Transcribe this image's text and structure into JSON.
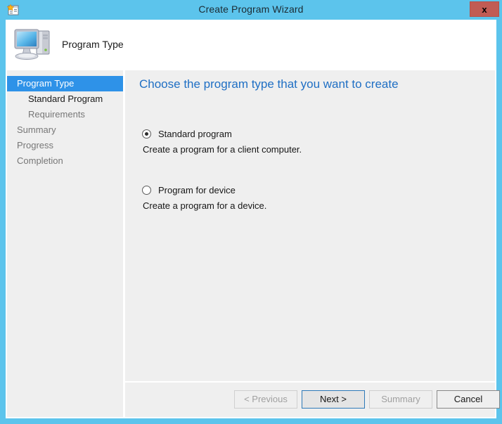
{
  "window": {
    "title": "Create Program Wizard",
    "icon": "new-program-window-icon",
    "close_label": "x",
    "accent_color": "#5CC4EC",
    "close_button_color": "#C15C54"
  },
  "header": {
    "icon": "computer-icon",
    "label": "Program Type"
  },
  "sidebar": {
    "items": [
      {
        "label": "Program Type",
        "state": "active",
        "indent": false
      },
      {
        "label": "Standard Program",
        "state": "completed",
        "indent": true
      },
      {
        "label": "Requirements",
        "state": "pending",
        "indent": true
      },
      {
        "label": "Summary",
        "state": "pending",
        "indent": false
      },
      {
        "label": "Progress",
        "state": "pending",
        "indent": false
      },
      {
        "label": "Completion",
        "state": "pending",
        "indent": false
      }
    ],
    "active_color": "#2E92E8"
  },
  "content": {
    "heading": "Choose the program type that you want to create",
    "heading_color": "#1F6FC4",
    "options": [
      {
        "label": "Standard program",
        "description": "Create a program for a client computer.",
        "selected": true
      },
      {
        "label": "Program for device",
        "description": "Create a program for a device.",
        "selected": false
      }
    ]
  },
  "buttons": {
    "previous": {
      "label": "< Previous",
      "state": "disabled"
    },
    "next": {
      "label": "Next >",
      "state": "focused"
    },
    "summary": {
      "label": "Summary",
      "state": "disabled"
    },
    "cancel": {
      "label": "Cancel",
      "state": "normal"
    }
  }
}
